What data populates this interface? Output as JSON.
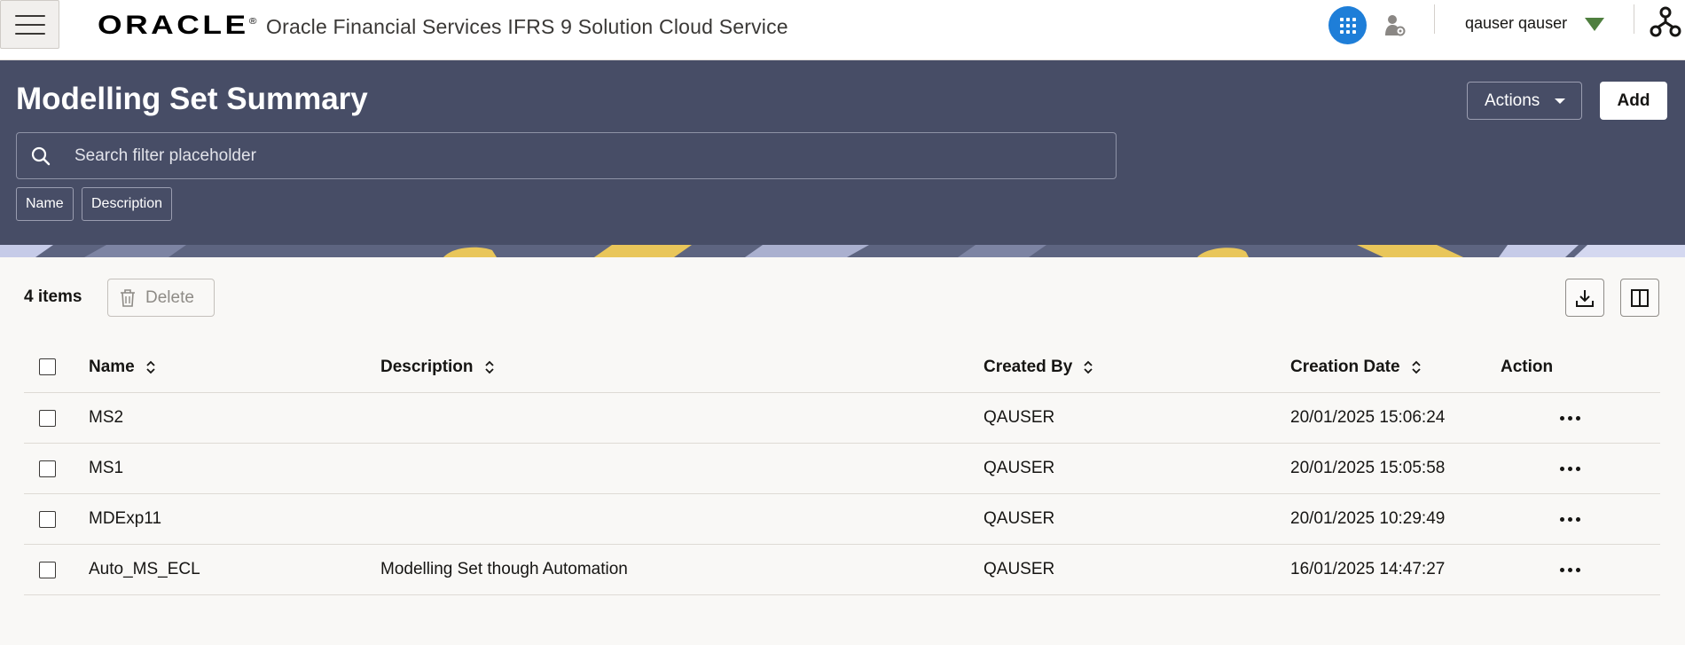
{
  "header": {
    "brand": "ORACLE",
    "app_title": "Oracle Financial Services IFRS 9 Solution Cloud Service",
    "user_name": "qauser qauser",
    "apps_color": "#1e7ed8"
  },
  "page": {
    "title": "Modelling Set Summary",
    "search_placeholder": "Search filter placeholder",
    "filter_chips": [
      "Name",
      "Description"
    ],
    "actions_label": "Actions",
    "add_label": "Add",
    "band_color": "#474d66"
  },
  "toolbar": {
    "items_count": "4 items",
    "delete_label": "Delete"
  },
  "table": {
    "columns": {
      "name": "Name",
      "description": "Description",
      "created_by": "Created By",
      "creation_date": "Creation Date",
      "action": "Action"
    },
    "rows": [
      {
        "name": "MS2",
        "description": "",
        "created_by": "QAUSER",
        "creation_date": "20/01/2025 15:06:24"
      },
      {
        "name": "MS1",
        "description": "",
        "created_by": "QAUSER",
        "creation_date": "20/01/2025 15:05:58"
      },
      {
        "name": "MDExp11",
        "description": "",
        "created_by": "QAUSER",
        "creation_date": "20/01/2025 10:29:49"
      },
      {
        "name": "Auto_MS_ECL",
        "description": "Modelling Set though Automation",
        "created_by": "QAUSER",
        "creation_date": "16/01/2025 14:47:27"
      }
    ]
  },
  "icons": {
    "menu": "hamburger-icon",
    "apps": "grid-icon",
    "admin": "user-gear-icon",
    "user_menu": "caret-down-icon",
    "org": "hierarchy-icon",
    "search": "search-icon",
    "delete": "trash-icon",
    "download": "download-icon",
    "columns": "column-panel-icon",
    "row_action": "more-horizontal-icon"
  }
}
